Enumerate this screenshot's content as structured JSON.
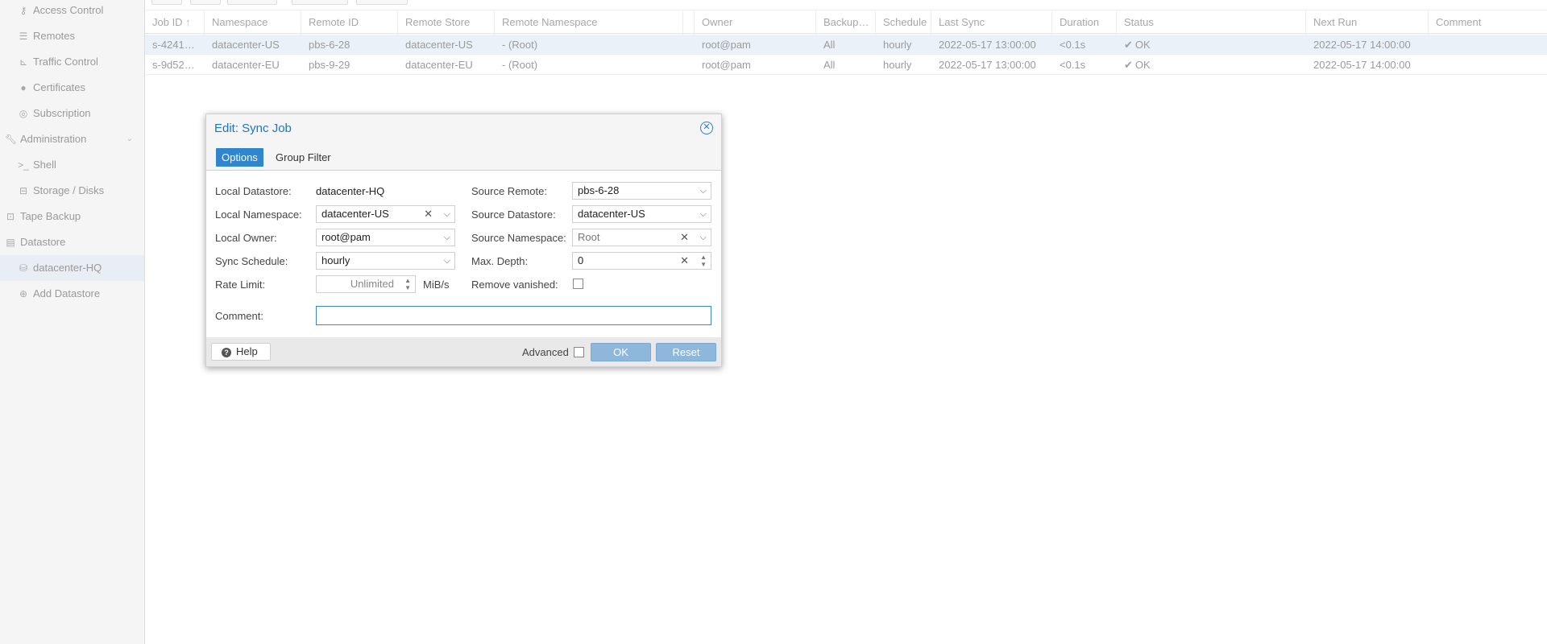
{
  "sidebar": {
    "items": [
      {
        "label": "Access Control",
        "icon": "key-icon"
      },
      {
        "label": "Remotes",
        "icon": "server-icon"
      },
      {
        "label": "Traffic Control",
        "icon": "signal-icon"
      },
      {
        "label": "Certificates",
        "icon": "certificate-icon"
      },
      {
        "label": "Subscription",
        "icon": "support-icon"
      },
      {
        "label": "Administration",
        "icon": "wrench-icon"
      },
      {
        "label": "Shell",
        "icon": "terminal-icon"
      },
      {
        "label": "Storage / Disks",
        "icon": "hdd-icon"
      },
      {
        "label": "Tape Backup",
        "icon": "tape-icon"
      },
      {
        "label": "Datastore",
        "icon": "archive-icon"
      },
      {
        "label": "datacenter-HQ",
        "icon": "database-icon"
      },
      {
        "label": "Add Datastore",
        "icon": "plus-circle-icon"
      }
    ]
  },
  "grid": {
    "columns": [
      "Job ID",
      "Namespace",
      "Remote ID",
      "Remote Store",
      "Remote Namespace",
      "Owner",
      "Backup…",
      "Schedule",
      "Last Sync",
      "Duration",
      "Status",
      "Next Run",
      "Comment"
    ],
    "rows": [
      {
        "job_id": "s-4241…",
        "namespace": "datacenter-US",
        "remote_id": "pbs-6-28",
        "remote_store": "datacenter-US",
        "remote_ns": "- (Root)",
        "owner": "root@pam",
        "backup": "All",
        "schedule": "hourly",
        "last_sync": "2022-05-17 13:00:00",
        "duration": "<0.1s",
        "status": "OK",
        "next_run": "2022-05-17 14:00:00",
        "comment": ""
      },
      {
        "job_id": "s-9d52…",
        "namespace": "datacenter-EU",
        "remote_id": "pbs-9-29",
        "remote_store": "datacenter-EU",
        "remote_ns": "- (Root)",
        "owner": "root@pam",
        "backup": "All",
        "schedule": "hourly",
        "last_sync": "2022-05-17 13:00:00",
        "duration": "<0.1s",
        "status": "OK",
        "next_run": "2022-05-17 14:00:00",
        "comment": ""
      }
    ]
  },
  "dialog": {
    "title": "Edit: Sync Job",
    "tabs": [
      "Options",
      "Group Filter"
    ],
    "labels": {
      "local_datastore": "Local Datastore:",
      "local_namespace": "Local Namespace:",
      "local_owner": "Local Owner:",
      "sync_schedule": "Sync Schedule:",
      "rate_limit": "Rate Limit:",
      "source_remote": "Source Remote:",
      "source_datastore": "Source Datastore:",
      "source_namespace": "Source Namespace:",
      "max_depth": "Max. Depth:",
      "remove_vanished": "Remove vanished:",
      "comment": "Comment:",
      "rate_unit": "MiB/s"
    },
    "values": {
      "local_datastore": "datacenter-HQ",
      "local_namespace": "datacenter-US",
      "local_owner": "root@pam",
      "sync_schedule": "hourly",
      "rate_limit_placeholder": "Unlimited",
      "source_remote": "pbs-6-28",
      "source_datastore": "datacenter-US",
      "source_namespace": "Root",
      "max_depth": "0",
      "comment": ""
    },
    "footer": {
      "help": "Help",
      "advanced": "Advanced",
      "ok": "OK",
      "reset": "Reset"
    }
  }
}
